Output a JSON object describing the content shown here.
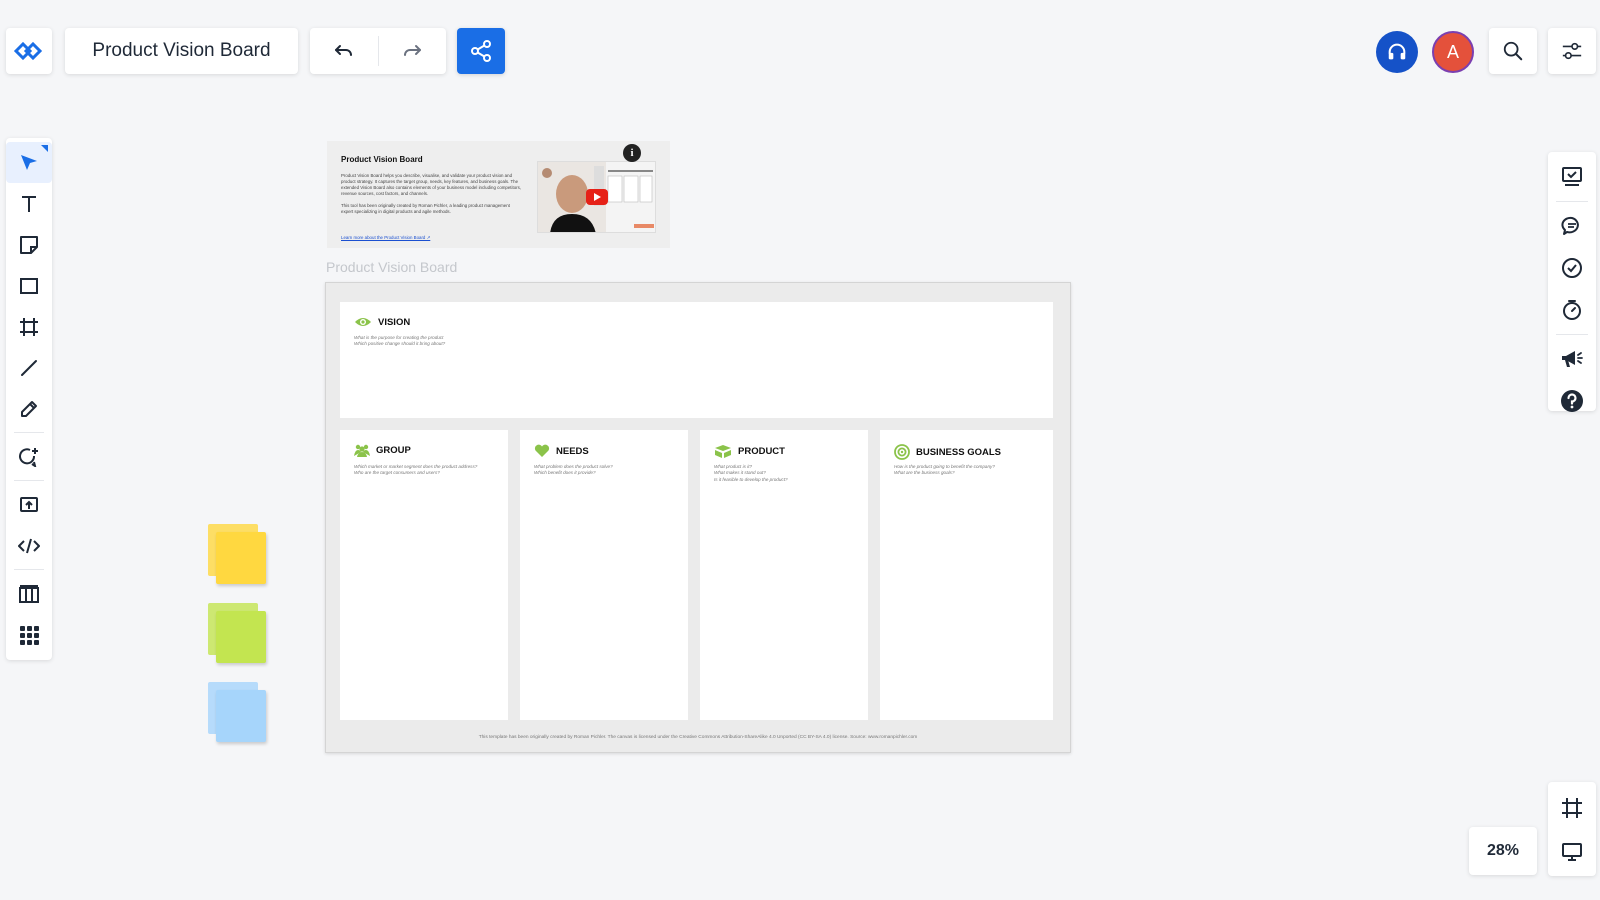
{
  "document": {
    "title": "Product Vision Board"
  },
  "colors": {
    "accent": "#1a6ee6",
    "headset": "#1552c8",
    "avatar_bg": "#e4513b",
    "avatar_ring": "#7b3fb0",
    "sticky_yellow": "#ffd840",
    "sticky_green": "#c3e550",
    "sticky_blue": "#a6d5fb",
    "board_green": "#8bc34a"
  },
  "topbar": {
    "logo_icon": "app-logo-icon",
    "undo_icon": "undo-icon",
    "redo_icon": "redo-icon",
    "share_icon": "share-icon",
    "headset_icon": "headset-icon",
    "avatar_initial": "A",
    "search_icon": "search-icon",
    "settings_icon": "sliders-icon"
  },
  "left_toolbar": {
    "tools": [
      "select",
      "text",
      "sticky-note",
      "shape",
      "frame",
      "line",
      "pen",
      "comment-add",
      "upload",
      "embed-code",
      "table",
      "apps"
    ]
  },
  "right_toolbar": {
    "tools": [
      "presentation-check",
      "chat",
      "checklist",
      "timer",
      "announcement",
      "help"
    ]
  },
  "view": {
    "zoom": "28%"
  },
  "info_card": {
    "title": "Product Vision Board",
    "description": "Product Vision Board helps you describe, visualise, and validate your product vision and product strategy. It captures the target group, needs, key features, and business goals. The extended Vision Board also contains elements of your business model including competitors, revenue sources, cost factors, and channels.",
    "credit": "This tool has been originally created by Roman Pichler, a leading product management expert specializing in digital products and agile methods.",
    "link": "Learn more about the Product Vision Board ↗",
    "info_badge": "i"
  },
  "board": {
    "frame_label": "Product Vision Board",
    "vision": {
      "title": "VISION",
      "questions": "What is the purpose for creating the product\nWhich positive change should it bring about?"
    },
    "columns": [
      {
        "title": "GROUP",
        "icon": "group-icon",
        "questions": "Which market or market segment does the product address?\nWho are the target consumers and users?"
      },
      {
        "title": "NEEDS",
        "icon": "heart-icon",
        "questions": "What problem does the product solve?\nWhich benefit does it provide?"
      },
      {
        "title": "PRODUCT",
        "icon": "box-icon",
        "questions": "What product is it?\nWhat makes it stand out?\nIs it feasible to develop the product?"
      },
      {
        "title": "BUSINESS GOALS",
        "icon": "target-icon",
        "questions": "How is the product going to benefit the company?\nWhat are the business goals?"
      }
    ],
    "footer": "This template has been originally created by Roman Pichler. The canvas is licensed under the Creative Commons Attribution-ShareAlike 4.0 Unported (CC BY-SA 4.0) license. Source: www.romanpichler.com"
  }
}
